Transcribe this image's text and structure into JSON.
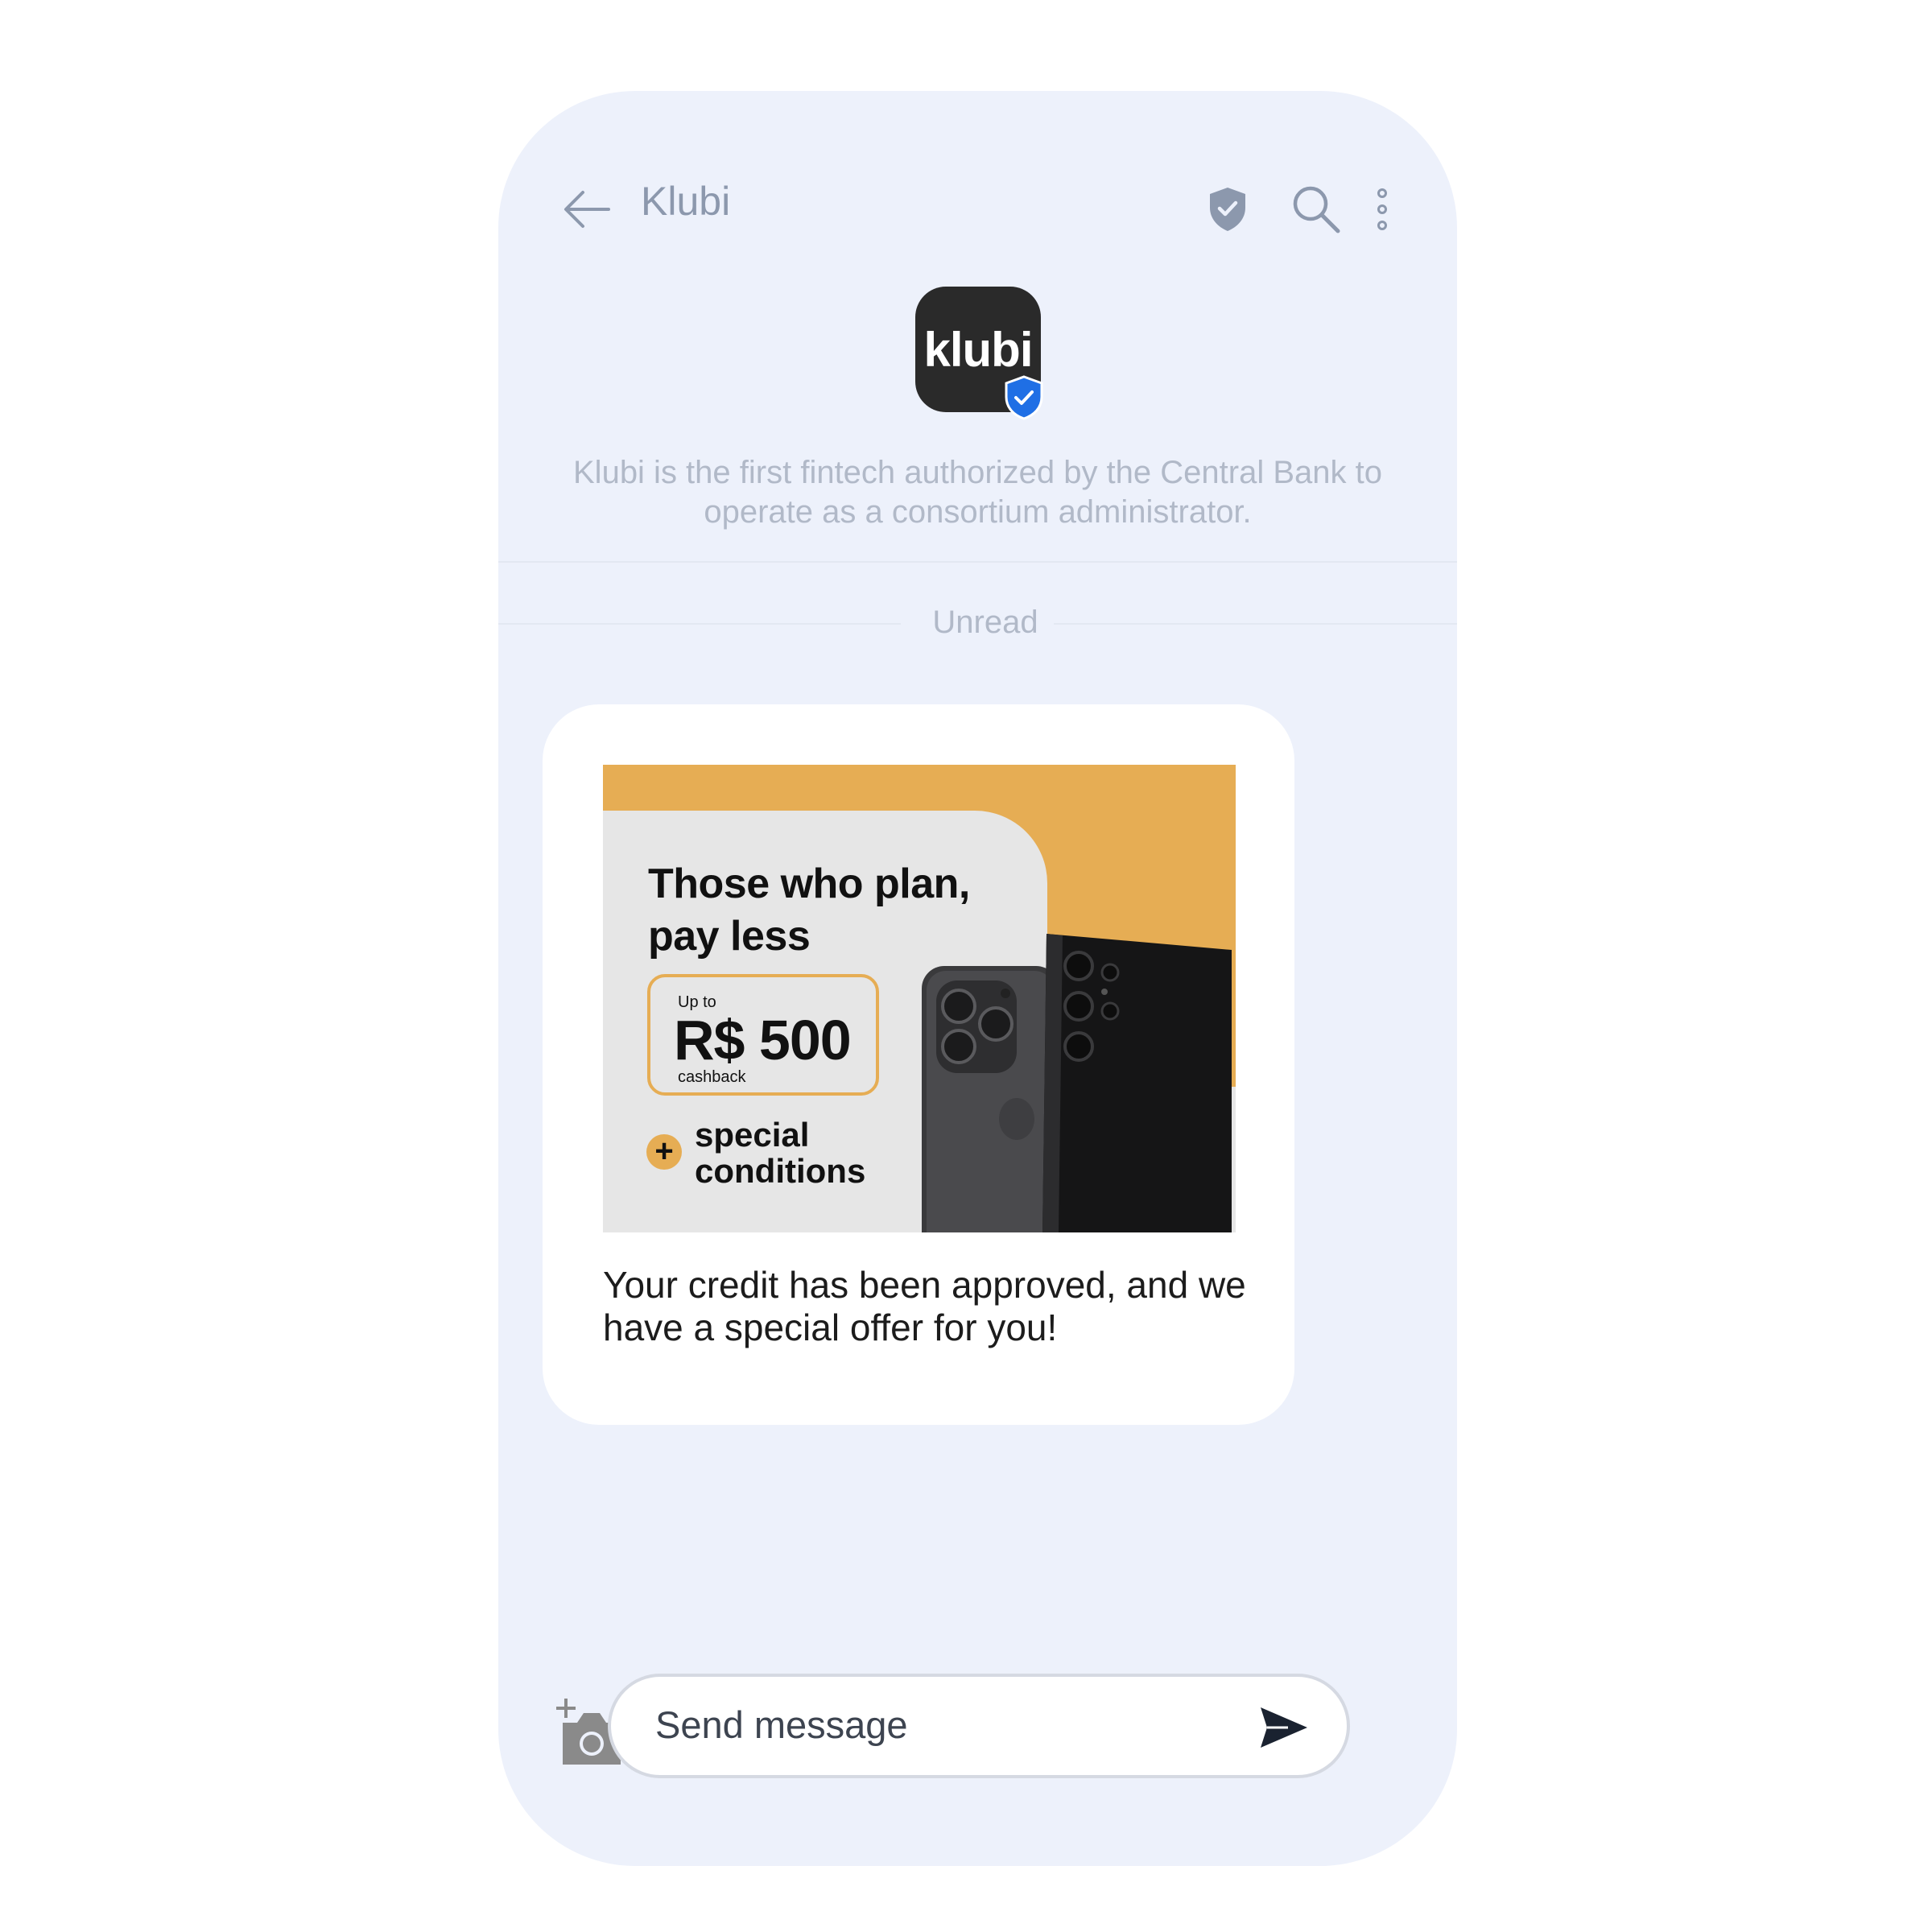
{
  "header": {
    "title": "Klubi",
    "back_icon": "arrow-left-icon",
    "verified_icon": "shield-check-icon",
    "search_icon": "search-icon",
    "menu_icon": "more-vertical-icon"
  },
  "profile": {
    "logo_text": "klubi",
    "verified_badge_icon": "verified-shield-icon",
    "description": "Klubi is the first fintech authorized by the Central Bank to operate as a consortium administrator."
  },
  "divider": {
    "label": "Unread"
  },
  "message": {
    "promo": {
      "headline_line1": "Those who plan,",
      "headline_line2": "pay less",
      "cashback_prefix": "Up to",
      "cashback_amount": "R$ 500",
      "cashback_suffix": "cashback",
      "plus_symbol": "+",
      "extra_line1": "special",
      "extra_line2": "conditions"
    },
    "text": "Your credit has been approved, and we have a special offer for you!"
  },
  "composer": {
    "attach_icon": "add-photo-camera-icon",
    "placeholder": "Send message",
    "send_icon": "send-icon"
  },
  "colors": {
    "phone_bg": "#edf1fb",
    "header_text": "#8c98ad",
    "accent_orange": "#e6ad54",
    "logo_bg": "#2a2a2a",
    "verified_blue": "#1f6fe5"
  }
}
